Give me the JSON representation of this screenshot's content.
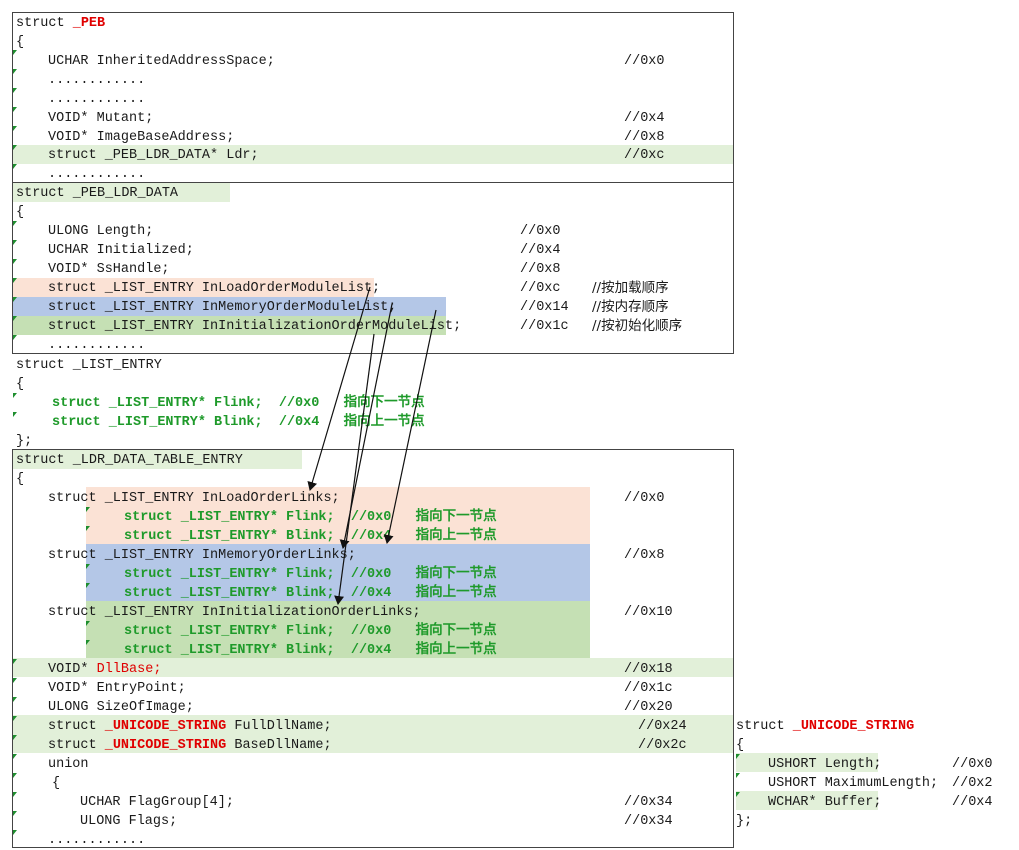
{
  "colors": {
    "light_green": "#e2f0d9",
    "peach": "#fbe2d5",
    "blue": "#b4c7e7",
    "green": "#c5e0b4",
    "red": "#e00000",
    "green_text": "#1e9a2a",
    "arrow": "#111111"
  },
  "peb": {
    "struct_kw": "struct ",
    "name": "_PEB",
    "brace_open": "{",
    "lines": [
      {
        "text": "UCHAR InheritedAddressSpace;",
        "offset": "//0x0"
      },
      {
        "text": "............",
        "offset": ""
      },
      {
        "text": "............",
        "offset": ""
      },
      {
        "text": "VOID* Mutant;",
        "offset": "//0x4"
      },
      {
        "text": "VOID* ImageBaseAddress;",
        "offset": "//0x8"
      },
      {
        "text": "struct _PEB_LDR_DATA* Ldr;",
        "offset": "//0xc"
      },
      {
        "text": "............",
        "offset": ""
      }
    ]
  },
  "ldr_data": {
    "header": "struct _PEB_LDR_DATA",
    "brace_open": "{",
    "lines": [
      {
        "text": "ULONG Length;",
        "offset": "//0x0",
        "comment": ""
      },
      {
        "text": "UCHAR Initialized;",
        "offset": "//0x4",
        "comment": ""
      },
      {
        "text": "VOID* SsHandle;",
        "offset": "//0x8",
        "comment": ""
      },
      {
        "text": "struct _LIST_ENTRY InLoadOrderModuleList;",
        "offset": "//0xc",
        "comment": "//按加载顺序"
      },
      {
        "text": "struct _LIST_ENTRY InMemoryOrderModuleList;",
        "offset": "//0x14",
        "comment": "//按内存顺序"
      },
      {
        "text": "struct _LIST_ENTRY InInitializationOrderModuleList;",
        "offset": "//0x1c",
        "comment": "//按初始化顺序"
      },
      {
        "text": "............",
        "offset": "",
        "comment": ""
      }
    ]
  },
  "list_entry": {
    "header": "struct _LIST_ENTRY",
    "brace_open": "{",
    "flink": "struct _LIST_ENTRY* Flink;  //0x0   指向下一节点",
    "blink": "struct _LIST_ENTRY* Blink;  //0x4   指向上一节点",
    "brace_close": "};"
  },
  "ldr_entry": {
    "header": "struct _LDR_DATA_TABLE_ENTRY",
    "brace_open": "{",
    "load_links": {
      "text": "struct _LIST_ENTRY InLoadOrderLinks;",
      "offset": "//0x0"
    },
    "memory_links": {
      "text": "struct _LIST_ENTRY InMemoryOrderLinks;",
      "offset": "//0x8"
    },
    "init_links": {
      "text": "struct _LIST_ENTRY InInitializationOrderLinks;",
      "offset": "//0x10"
    },
    "flink": "struct _LIST_ENTRY* Flink;  //0x0   指向下一节点",
    "blink": "struct _LIST_ENTRY* Blink;  //0x4   指向上一节点",
    "dllbase_type": "VOID* ",
    "dllbase_name": "DllBase;",
    "dllbase_offset": "//0x18",
    "entry_point": {
      "text": "VOID* EntryPoint;",
      "offset": "//0x1c"
    },
    "size_of_image": {
      "text": "ULONG SizeOfImage;",
      "offset": "//0x20"
    },
    "full_name": {
      "kw": "struct ",
      "type": "_UNICODE_STRING",
      "rest": " FullDllName;",
      "offset": "//0x24"
    },
    "base_name": {
      "kw": "struct ",
      "type": "_UNICODE_STRING",
      "rest": " BaseDllName;",
      "offset": "//0x2c"
    },
    "union_kw": "union",
    "union_open": "{",
    "flag_group": {
      "text": "UCHAR FlagGroup[4];",
      "offset": "//0x34"
    },
    "flags": {
      "text": "ULONG Flags;",
      "offset": "//0x34"
    },
    "ellipsis": "............"
  },
  "unicode_string": {
    "struct_kw": "struct ",
    "name": "_UNICODE_STRING",
    "brace_open": "{",
    "lines": [
      {
        "text": "USHORT Length;",
        "offset": "//0x0"
      },
      {
        "text": "USHORT MaximumLength;",
        "offset": "//0x2"
      },
      {
        "text": "WCHAR* Buffer;",
        "offset": "//0x4"
      }
    ],
    "brace_close": "};"
  }
}
